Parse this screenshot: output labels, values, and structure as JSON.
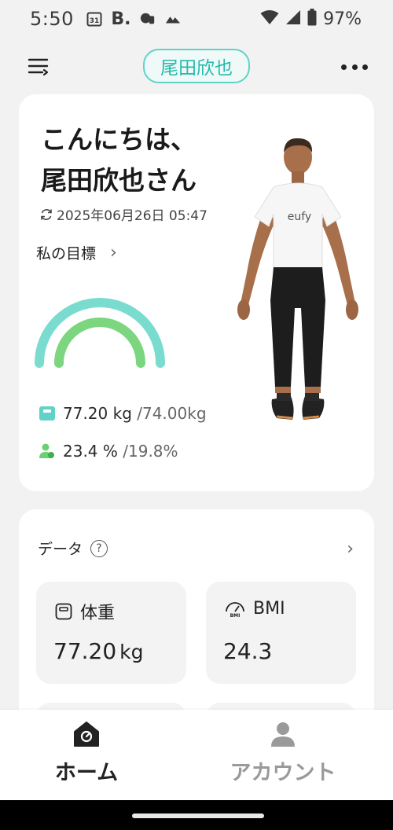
{
  "status_bar": {
    "time": "5:50",
    "calendar_day": "31",
    "battery": "97%"
  },
  "header": {
    "user_name": "尾田欣也"
  },
  "hero": {
    "greeting_line1": "こんにちは、",
    "greeting_line2": "尾田欣也さん",
    "sync_time": "2025年06月26日 05:47",
    "goal_label": "私の目標",
    "weight_value": "77.20 kg",
    "weight_target": " /74.00kg",
    "bodyfat_value": "23.4 %",
    "bodyfat_target": " /19.8%",
    "avatar_shirt_text": "eufy",
    "colors": {
      "gauge_outer": "#79dccf",
      "gauge_inner": "#7bd67f"
    }
  },
  "data_card": {
    "title": "データ",
    "help": "?",
    "tiles": [
      {
        "title": "体重",
        "value": "77.20",
        "unit": "kg",
        "icon": "scale-icon"
      },
      {
        "title": "BMI",
        "value": "24.3",
        "unit": "",
        "icon": "bmi-gauge-icon"
      }
    ]
  },
  "bottom_nav": {
    "home_label": "ホーム",
    "account_label": "アカウント"
  }
}
